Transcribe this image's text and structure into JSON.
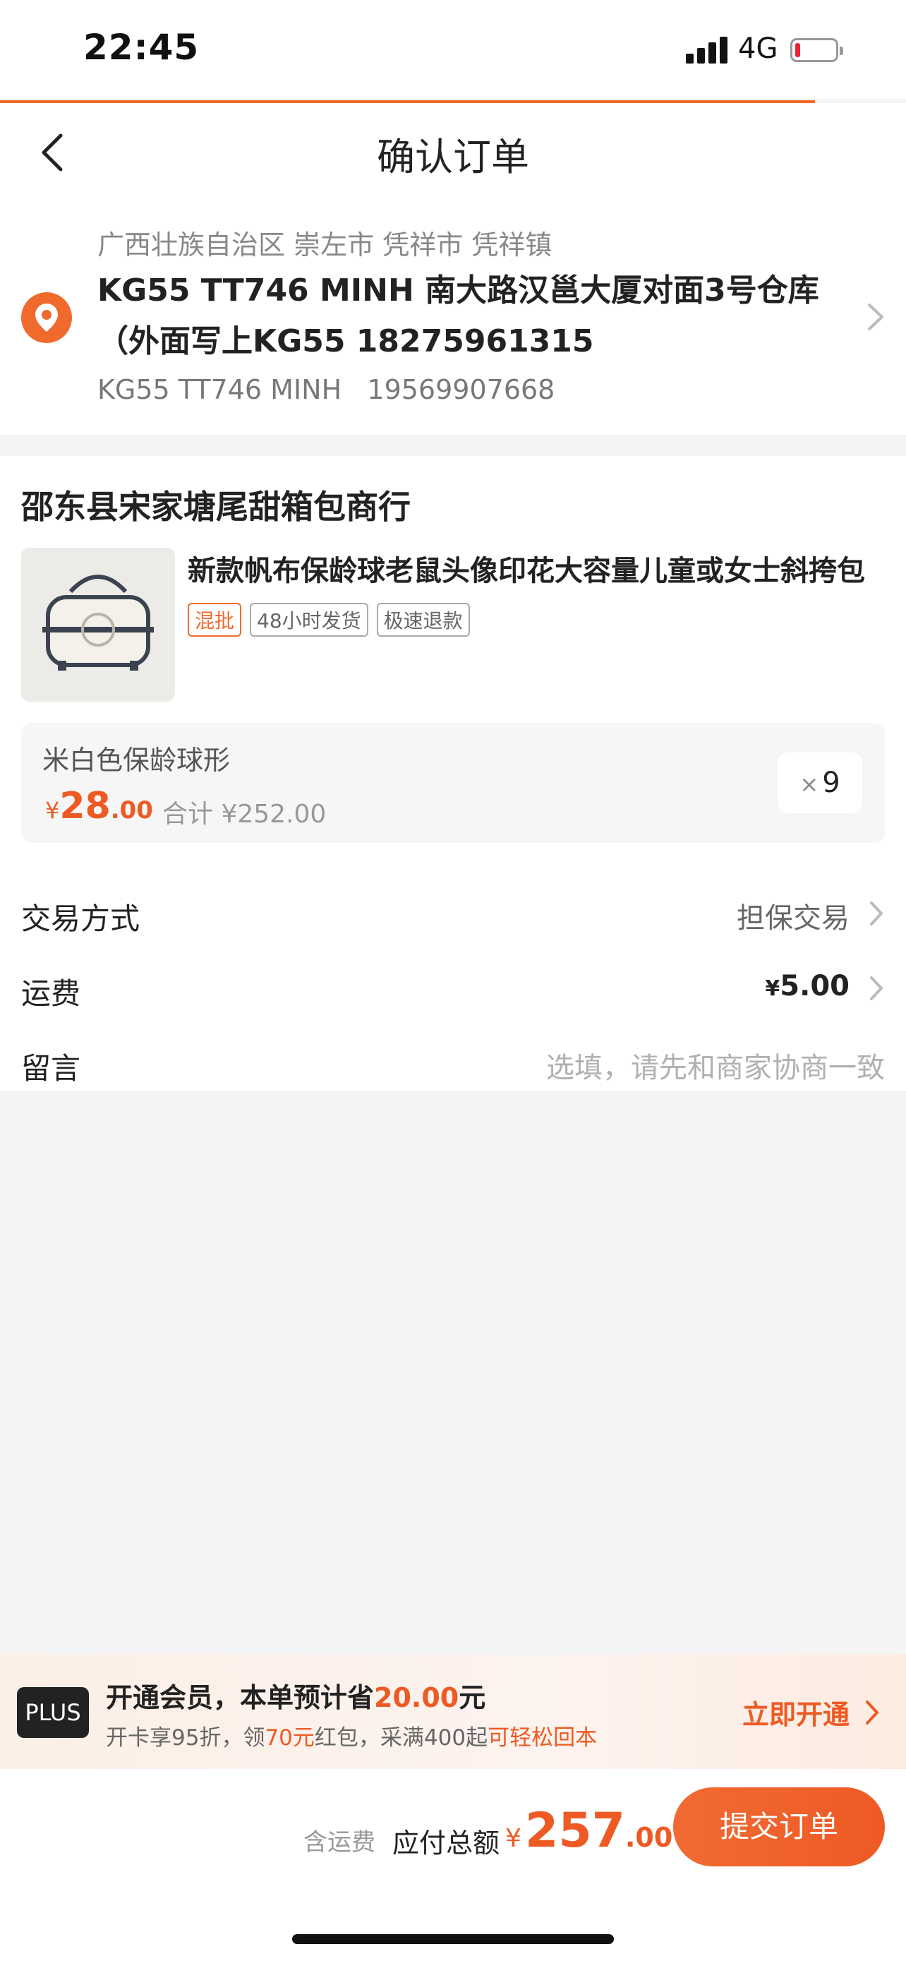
{
  "status_bar": {
    "time": "22:45",
    "network": "4G"
  },
  "nav": {
    "title": "确认订单"
  },
  "address": {
    "region": "广西壮族自治区 崇左市 凭祥市 凭祥镇",
    "detail": "KG55 TT746 MINH 南大路汉邕大厦对面3号仓库（外面写上KG55 18275961315",
    "contact_name": "KG55 TT746 MINH",
    "contact_phone": "19569907668"
  },
  "shop": {
    "name": "邵东县宋家塘尾甜箱包商行",
    "product": {
      "title": "新款帆布保龄球老鼠头像印花大容量儿童或女士斜挎包",
      "tags": [
        "混批",
        "48小时发货",
        "极速退款"
      ],
      "sku": "米白色保龄球形",
      "price_currency": "¥",
      "price_int": "28",
      "price_dec": ".00",
      "subtotal": "合计 ¥252.00",
      "qty_symbol": "×",
      "qty": "9"
    },
    "rows": {
      "trade_label": "交易方式",
      "trade_value": "担保交易",
      "shipping_label": "运费",
      "shipping_currency": "¥",
      "shipping_value": "5.00",
      "message_label": "留言",
      "message_placeholder": "选填，请先和商家协商一致"
    }
  },
  "plus": {
    "badge": "PLUS",
    "line1_a": "开通会员，本单预计省",
    "line1_amount": "20.00",
    "line1_b": "元",
    "line2_a": "开卡享95折，领",
    "line2_red": "70元",
    "line2_b": "红包，采满400起",
    "line2_tail": "可轻松回本",
    "cta": "立即开通"
  },
  "footer": {
    "shipping_note": "含运费",
    "total_label": "应付总额",
    "total_currency": "¥",
    "total_int": "257",
    "total_dec": ".00",
    "submit": "提交订单"
  },
  "colors": {
    "accent": "#ee5a24",
    "background": "#f4f4f4"
  }
}
